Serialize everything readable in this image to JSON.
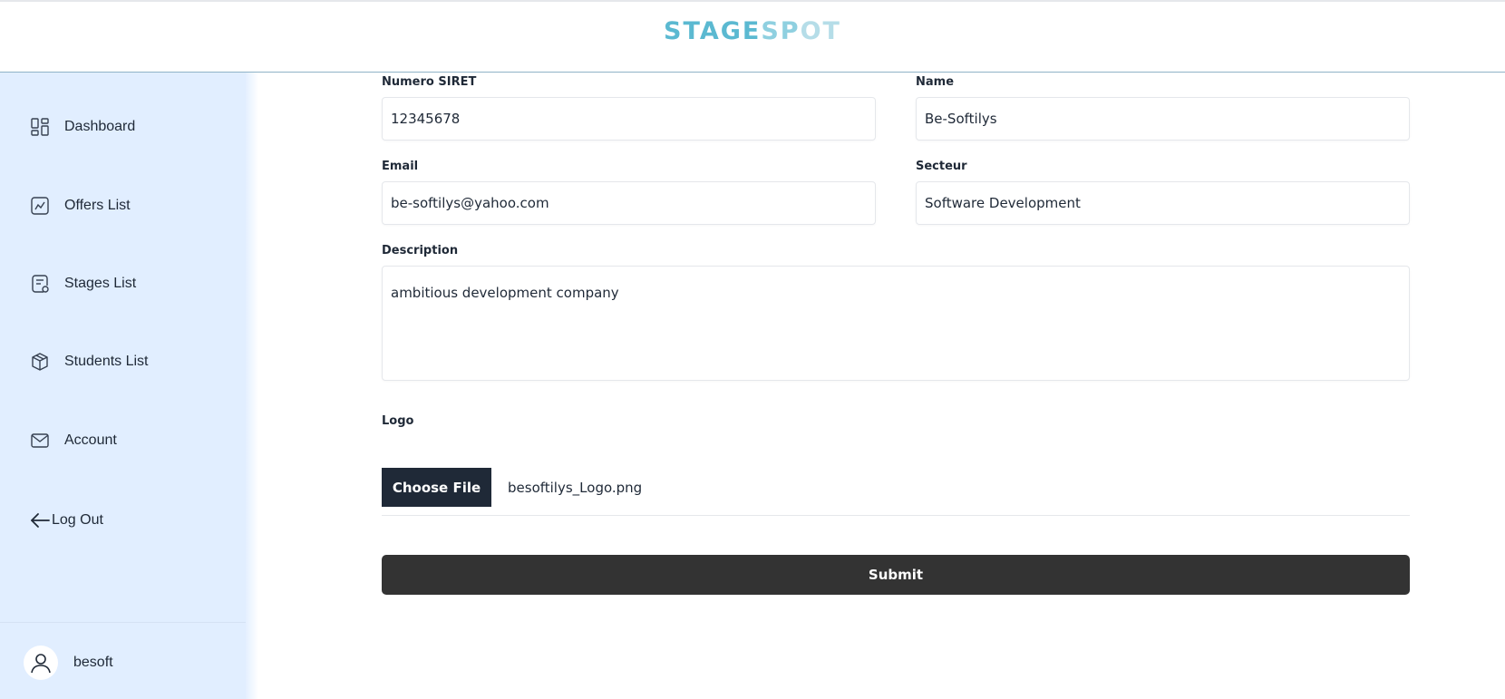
{
  "brand": {
    "logo_text": "STAGESPOT"
  },
  "sidebar": {
    "items": [
      {
        "label": "Dashboard",
        "icon": "dashboard-icon"
      },
      {
        "label": "Offers List",
        "icon": "chart-icon"
      },
      {
        "label": "Stages List",
        "icon": "stages-icon"
      },
      {
        "label": "Students List",
        "icon": "box-icon"
      },
      {
        "label": "Account",
        "icon": "mail-icon"
      },
      {
        "label": "Log Out",
        "icon": "arrow-left-icon"
      }
    ],
    "user": {
      "name": "besoft",
      "icon": "user-icon"
    }
  },
  "form": {
    "siret": {
      "label": "Numero SIRET",
      "value": "12345678"
    },
    "name": {
      "label": "Name",
      "value": "Be-Softilys"
    },
    "email": {
      "label": "Email",
      "value": "be-softilys@yahoo.com"
    },
    "secteur": {
      "label": "Secteur",
      "value": "Software Development"
    },
    "description": {
      "label": "Description",
      "value": "ambitious development company"
    },
    "logo": {
      "label": "Logo",
      "button_label": "Choose File",
      "file_name": "besoftilys_Logo.png"
    },
    "submit_label": "Submit"
  },
  "colors": {
    "sidebar_bg": "#e1eeff",
    "logo_primary": "#5bb9d1",
    "button_dark": "#1f2937",
    "submit_bg": "#333333"
  }
}
